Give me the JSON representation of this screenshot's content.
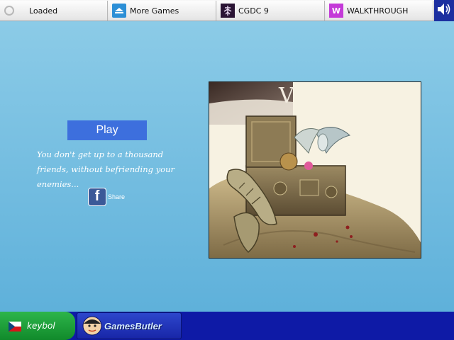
{
  "topbar": {
    "tabs": [
      {
        "label": "Loaded",
        "icon": "loading-spinner-icon"
      },
      {
        "label": "More Games",
        "icon": "games-icon"
      },
      {
        "label": "CGDC 9",
        "icon": "cgdc-logo-icon"
      },
      {
        "label": "WALKTHROUGH",
        "icon": "walkthrough-icon",
        "icon_letter": "W"
      }
    ],
    "sound_icon": "speaker-icon"
  },
  "menu": {
    "play_label": "Play",
    "tagline": "You don't get up to a thousand friends, without befriending your enemies...",
    "share_label": "Share",
    "share_icon": "facebook-icon",
    "share_icon_letter": "f"
  },
  "artwork": {
    "title_letter": "V"
  },
  "bottombar": {
    "sponsor_label": "keybol",
    "sponsor_icon": "flag-icon",
    "brand_label": "GamesButler",
    "brand_icon": "mascot-icon"
  },
  "colors": {
    "background": "#8fcde8",
    "play_button": "#3d6fdd",
    "bottom_bar": "#0e1aa6",
    "sponsor_green": "#2db54a",
    "facebook": "#3b5998"
  }
}
